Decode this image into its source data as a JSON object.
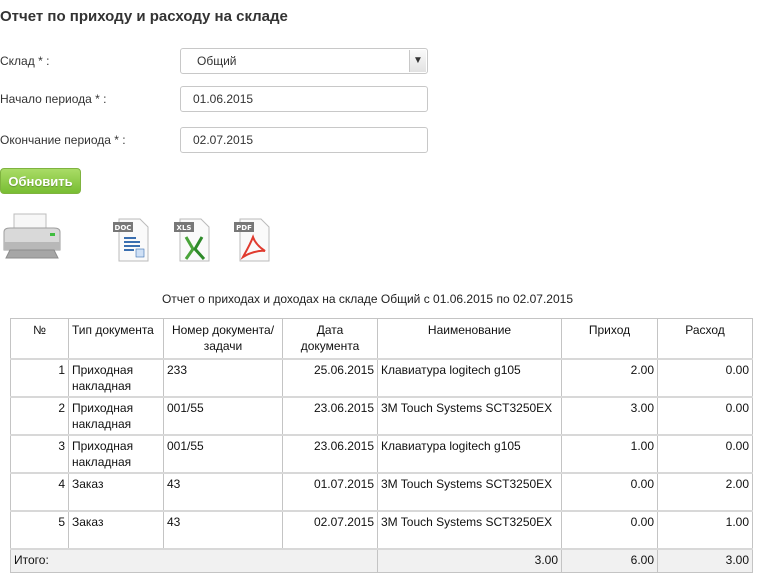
{
  "page": {
    "title": "Отчет по приходу и расходу на складе"
  },
  "form": {
    "warehouse_label": "Склад * :",
    "warehouse_value": "Общий",
    "start_label": "Начало периода * :",
    "start_value": "01.06.2015",
    "end_label": "Окончание периода * :",
    "end_value": "02.07.2015",
    "refresh_label": "Обновить"
  },
  "exports": {
    "doc_label": "DOC",
    "xls_label": "XLS",
    "pdf_label": "PDF"
  },
  "colors": {
    "accent_green": "#8ccc4a",
    "pdf_red": "#e03b2f",
    "xls_green": "#4aa43a",
    "doc_blue": "#3a6fb0"
  },
  "report": {
    "caption": "Отчет о приходах и доходах на складе Общий с 01.06.2015 по 02.07.2015",
    "columns": [
      "№",
      "Тип документа",
      "Номер документа/задачи",
      "Дата документа",
      "Наименование",
      "Приход",
      "Расход"
    ],
    "rows": [
      {
        "n": "1",
        "type": "Приходная накладная",
        "number": "233",
        "date": "25.06.2015",
        "name": "Клавиатура logitech g105",
        "income": "2.00",
        "expense": "0.00"
      },
      {
        "n": "2",
        "type": "Приходная накладная",
        "number": "001/55",
        "date": "23.06.2015",
        "name": "3M Touch Systems SCT3250EX",
        "income": "3.00",
        "expense": "0.00"
      },
      {
        "n": "3",
        "type": "Приходная накладная",
        "number": "001/55",
        "date": "23.06.2015",
        "name": "Клавиатура logitech g105",
        "income": "1.00",
        "expense": "0.00"
      },
      {
        "n": "4",
        "type": "Заказ",
        "number": "43",
        "date": "01.07.2015",
        "name": "3M Touch Systems SCT3250EX",
        "income": "0.00",
        "expense": "2.00"
      },
      {
        "n": "5",
        "type": "Заказ",
        "number": "43",
        "date": "02.07.2015",
        "name": "3M Touch Systems SCT3250EX",
        "income": "0.00",
        "expense": "1.00"
      }
    ],
    "total": {
      "label": "Итого:",
      "qty": "3.00",
      "income": "6.00",
      "expense": "3.00"
    }
  }
}
